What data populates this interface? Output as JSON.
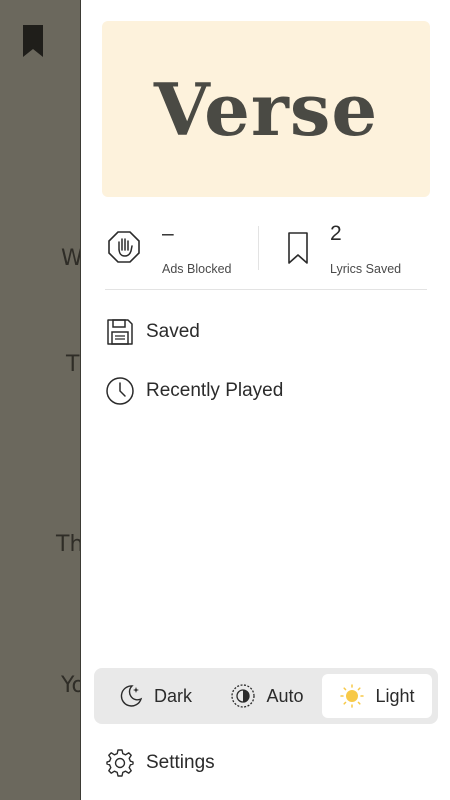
{
  "background": {
    "lines": [
      "W",
      "T",
      "Th",
      "Yo"
    ]
  },
  "logo": {
    "text": "Verse"
  },
  "stats": {
    "ads_blocked": {
      "value": "–",
      "label": "Ads Blocked"
    },
    "lyrics_saved": {
      "value": "2",
      "label": "Lyrics Saved"
    }
  },
  "nav": {
    "saved": "Saved",
    "recently_played": "Recently Played"
  },
  "theme": {
    "options": [
      "Dark",
      "Auto",
      "Light"
    ],
    "selected": "Light"
  },
  "settings": {
    "label": "Settings"
  },
  "colors": {
    "scrim": "#6b685d",
    "logo_bg": "#fdf2dc",
    "sun": "#f7c948",
    "text": "#2b2b2b"
  }
}
